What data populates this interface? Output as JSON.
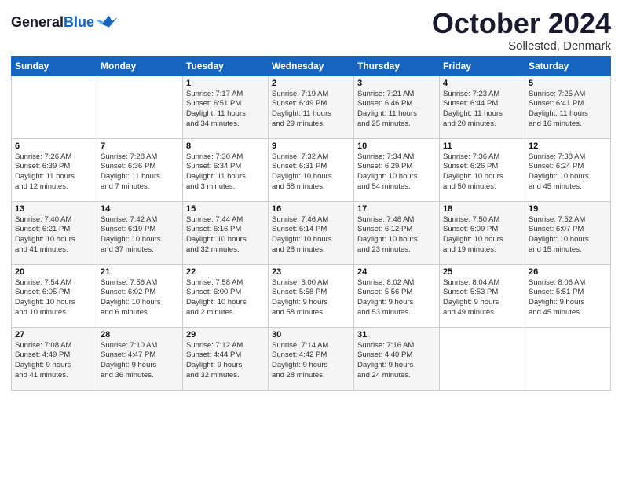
{
  "header": {
    "logo_line1": "General",
    "logo_line2": "Blue",
    "month_title": "October 2024",
    "location": "Sollested, Denmark"
  },
  "days_of_week": [
    "Sunday",
    "Monday",
    "Tuesday",
    "Wednesday",
    "Thursday",
    "Friday",
    "Saturday"
  ],
  "weeks": [
    [
      {
        "day": "",
        "content": ""
      },
      {
        "day": "",
        "content": ""
      },
      {
        "day": "1",
        "content": "Sunrise: 7:17 AM\nSunset: 6:51 PM\nDaylight: 11 hours\nand 34 minutes."
      },
      {
        "day": "2",
        "content": "Sunrise: 7:19 AM\nSunset: 6:49 PM\nDaylight: 11 hours\nand 29 minutes."
      },
      {
        "day": "3",
        "content": "Sunrise: 7:21 AM\nSunset: 6:46 PM\nDaylight: 11 hours\nand 25 minutes."
      },
      {
        "day": "4",
        "content": "Sunrise: 7:23 AM\nSunset: 6:44 PM\nDaylight: 11 hours\nand 20 minutes."
      },
      {
        "day": "5",
        "content": "Sunrise: 7:25 AM\nSunset: 6:41 PM\nDaylight: 11 hours\nand 16 minutes."
      }
    ],
    [
      {
        "day": "6",
        "content": "Sunrise: 7:26 AM\nSunset: 6:39 PM\nDaylight: 11 hours\nand 12 minutes."
      },
      {
        "day": "7",
        "content": "Sunrise: 7:28 AM\nSunset: 6:36 PM\nDaylight: 11 hours\nand 7 minutes."
      },
      {
        "day": "8",
        "content": "Sunrise: 7:30 AM\nSunset: 6:34 PM\nDaylight: 11 hours\nand 3 minutes."
      },
      {
        "day": "9",
        "content": "Sunrise: 7:32 AM\nSunset: 6:31 PM\nDaylight: 10 hours\nand 58 minutes."
      },
      {
        "day": "10",
        "content": "Sunrise: 7:34 AM\nSunset: 6:29 PM\nDaylight: 10 hours\nand 54 minutes."
      },
      {
        "day": "11",
        "content": "Sunrise: 7:36 AM\nSunset: 6:26 PM\nDaylight: 10 hours\nand 50 minutes."
      },
      {
        "day": "12",
        "content": "Sunrise: 7:38 AM\nSunset: 6:24 PM\nDaylight: 10 hours\nand 45 minutes."
      }
    ],
    [
      {
        "day": "13",
        "content": "Sunrise: 7:40 AM\nSunset: 6:21 PM\nDaylight: 10 hours\nand 41 minutes."
      },
      {
        "day": "14",
        "content": "Sunrise: 7:42 AM\nSunset: 6:19 PM\nDaylight: 10 hours\nand 37 minutes."
      },
      {
        "day": "15",
        "content": "Sunrise: 7:44 AM\nSunset: 6:16 PM\nDaylight: 10 hours\nand 32 minutes."
      },
      {
        "day": "16",
        "content": "Sunrise: 7:46 AM\nSunset: 6:14 PM\nDaylight: 10 hours\nand 28 minutes."
      },
      {
        "day": "17",
        "content": "Sunrise: 7:48 AM\nSunset: 6:12 PM\nDaylight: 10 hours\nand 23 minutes."
      },
      {
        "day": "18",
        "content": "Sunrise: 7:50 AM\nSunset: 6:09 PM\nDaylight: 10 hours\nand 19 minutes."
      },
      {
        "day": "19",
        "content": "Sunrise: 7:52 AM\nSunset: 6:07 PM\nDaylight: 10 hours\nand 15 minutes."
      }
    ],
    [
      {
        "day": "20",
        "content": "Sunrise: 7:54 AM\nSunset: 6:05 PM\nDaylight: 10 hours\nand 10 minutes."
      },
      {
        "day": "21",
        "content": "Sunrise: 7:56 AM\nSunset: 6:02 PM\nDaylight: 10 hours\nand 6 minutes."
      },
      {
        "day": "22",
        "content": "Sunrise: 7:58 AM\nSunset: 6:00 PM\nDaylight: 10 hours\nand 2 minutes."
      },
      {
        "day": "23",
        "content": "Sunrise: 8:00 AM\nSunset: 5:58 PM\nDaylight: 9 hours\nand 58 minutes."
      },
      {
        "day": "24",
        "content": "Sunrise: 8:02 AM\nSunset: 5:56 PM\nDaylight: 9 hours\nand 53 minutes."
      },
      {
        "day": "25",
        "content": "Sunrise: 8:04 AM\nSunset: 5:53 PM\nDaylight: 9 hours\nand 49 minutes."
      },
      {
        "day": "26",
        "content": "Sunrise: 8:06 AM\nSunset: 5:51 PM\nDaylight: 9 hours\nand 45 minutes."
      }
    ],
    [
      {
        "day": "27",
        "content": "Sunrise: 7:08 AM\nSunset: 4:49 PM\nDaylight: 9 hours\nand 41 minutes."
      },
      {
        "day": "28",
        "content": "Sunrise: 7:10 AM\nSunset: 4:47 PM\nDaylight: 9 hours\nand 36 minutes."
      },
      {
        "day": "29",
        "content": "Sunrise: 7:12 AM\nSunset: 4:44 PM\nDaylight: 9 hours\nand 32 minutes."
      },
      {
        "day": "30",
        "content": "Sunrise: 7:14 AM\nSunset: 4:42 PM\nDaylight: 9 hours\nand 28 minutes."
      },
      {
        "day": "31",
        "content": "Sunrise: 7:16 AM\nSunset: 4:40 PM\nDaylight: 9 hours\nand 24 minutes."
      },
      {
        "day": "",
        "content": ""
      },
      {
        "day": "",
        "content": ""
      }
    ]
  ]
}
